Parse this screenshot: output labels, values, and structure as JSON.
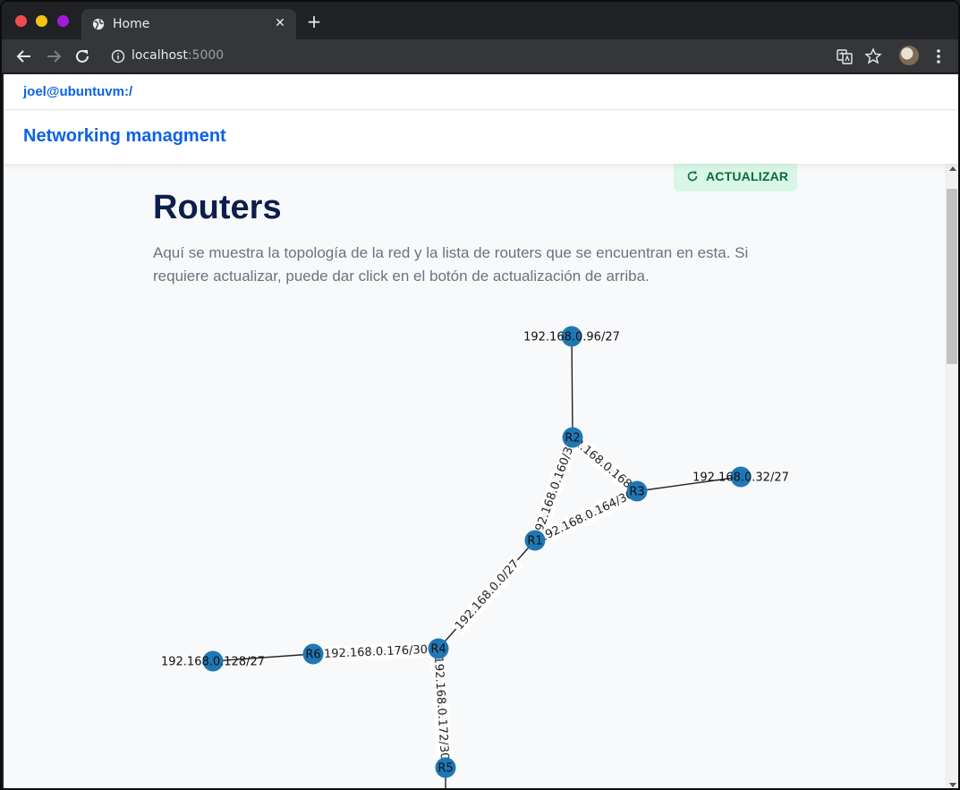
{
  "browser": {
    "tab_title": "Home",
    "new_tab_label": "+",
    "close_tab_label": "✕",
    "url_host": "localhost",
    "url_port": ":5000"
  },
  "topbar": {
    "user": "joel@ubuntuvm:/"
  },
  "header": {
    "brand": "Networking managment"
  },
  "toolbar": {
    "refresh_label": "ACTUALIZAR"
  },
  "main": {
    "title": "Routers",
    "description": "Aquí se muestra la topología de la red y la lista de routers que se encuentran en esta. Si requiere actualizar, puede dar click en el botón de actualización de arriba."
  },
  "topology": {
    "nodes": [
      {
        "id": "n96",
        "label": "192.168.0.96/27"
      },
      {
        "id": "R2",
        "label": "R2"
      },
      {
        "id": "R3",
        "label": "R3"
      },
      {
        "id": "n32",
        "label": "192.168.0.32/27"
      },
      {
        "id": "R1",
        "label": "R1"
      },
      {
        "id": "R4",
        "label": "R4"
      },
      {
        "id": "R6",
        "label": "R6"
      },
      {
        "id": "n128",
        "label": "192.168.0.128/27"
      },
      {
        "id": "R5",
        "label": "R5"
      }
    ],
    "edges": [
      {
        "from": "n96",
        "to": "R2",
        "label": ""
      },
      {
        "from": "R2",
        "to": "R3",
        "label": "192.168.0.168/30"
      },
      {
        "from": "R2",
        "to": "R1",
        "label": "192.168.0.160/30"
      },
      {
        "from": "R1",
        "to": "R3",
        "label": "192.168.0.164/30"
      },
      {
        "from": "R3",
        "to": "n32",
        "label": ""
      },
      {
        "from": "R1",
        "to": "R4",
        "label": "192.168.0.0/27"
      },
      {
        "from": "R6",
        "to": "R4",
        "label": "192.168.0.176/30"
      },
      {
        "from": "n128",
        "to": "R6",
        "label": ""
      },
      {
        "from": "R4",
        "to": "R5",
        "label": "192.168.0.172/30"
      }
    ],
    "node_color": "#1f77b4"
  }
}
